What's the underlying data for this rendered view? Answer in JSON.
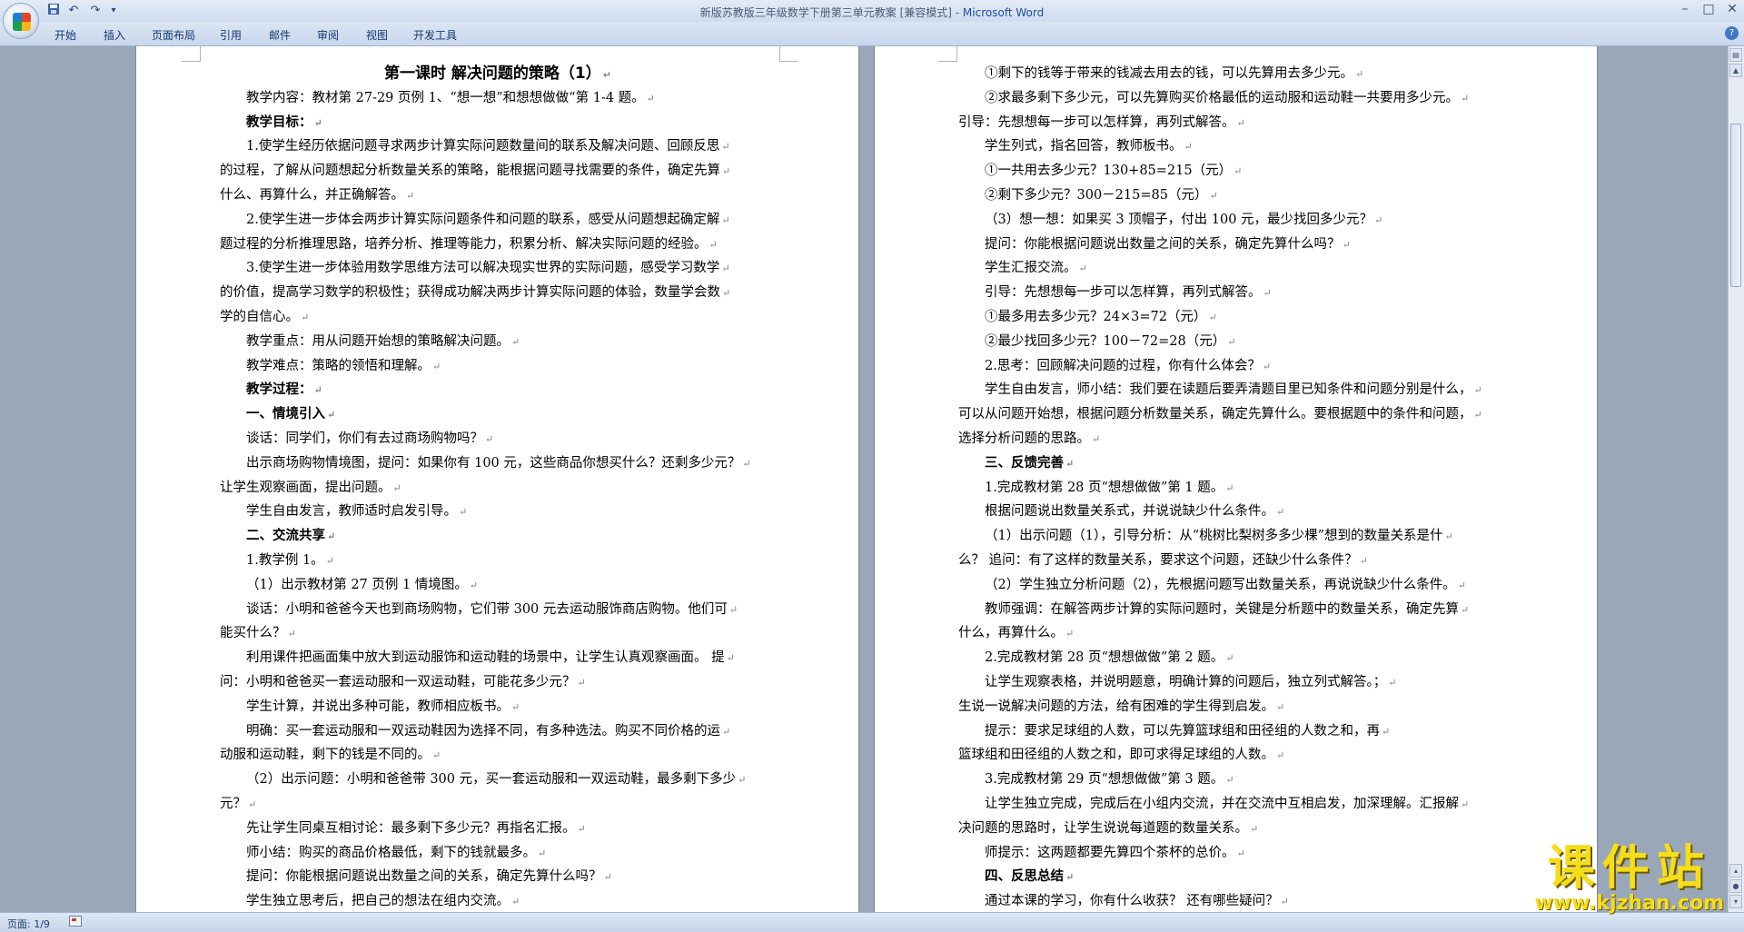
{
  "window": {
    "title": "新版苏教版三年级数学下册第三单元教案 [兼容模式] - ",
    "app_name": "Microsoft Word",
    "quick_access": {
      "save_icon": "save-icon",
      "undo": "↶",
      "redo": "↷",
      "customize": "▾"
    },
    "controls": {
      "minimize": "–",
      "maximize": "□",
      "close": "✕"
    }
  },
  "ribbon": {
    "tabs": [
      "开始",
      "插入",
      "页面布局",
      "引用",
      "邮件",
      "审阅",
      "视图",
      "开发工具"
    ],
    "help": "?"
  },
  "page_left": {
    "lines": [
      {
        "t": "第一课时  解决问题的策略（1）",
        "style": "title"
      },
      {
        "t": "教学内容：教材第 27-29 页例 1、“想一想”和想想做做“第 1-4 题。",
        "style": "ind"
      },
      {
        "t": "教学目标：",
        "style": "ind b"
      },
      {
        "t": "1.使学生经历依据问题寻求两步计算实际问题数量间的联系及解决问题、回顾反思",
        "style": "ind"
      },
      {
        "t": "的过程，了解从问题想起分析数量关系的策略，能根据问题寻找需要的条件，确定先算",
        "style": ""
      },
      {
        "t": "什么、再算什么，并正确解答。",
        "style": ""
      },
      {
        "t": "2.使学生进一步体会两步计算实际问题条件和问题的联系，感受从问题想起确定解",
        "style": "ind"
      },
      {
        "t": "题过程的分析推理思路，培养分析、推理等能力，积累分析、解决实际问题的经验。",
        "style": ""
      },
      {
        "t": "3.使学生进一步体验用数学思维方法可以解决现实世界的实际问题，感受学习数学",
        "style": "ind"
      },
      {
        "t": "的价值，提高学习数学的积极性；获得成功解决两步计算实际问题的体验，数量学会数",
        "style": ""
      },
      {
        "t": "学的自信心。",
        "style": ""
      },
      {
        "t": "教学重点：用从问题开始想的策略解决问题。",
        "style": "ind"
      },
      {
        "t": "教学难点：策略的领悟和理解。",
        "style": "ind"
      },
      {
        "t": "教学过程：",
        "style": "ind b"
      },
      {
        "t": "一、情境引入",
        "style": "ind b"
      },
      {
        "t": "谈话：同学们，你们有去过商场购物吗？",
        "style": "ind"
      },
      {
        "t": "出示商场购物情境图，提问：如果你有 100 元，这些商品你想买什么？还剩多少元？",
        "style": "ind"
      },
      {
        "t": "让学生观察画面，提出问题。",
        "style": ""
      },
      {
        "t": "学生自由发言，教师适时启发引导。",
        "style": "ind"
      },
      {
        "t": "二、交流共享",
        "style": "ind b"
      },
      {
        "t": "1.教学例 1。",
        "style": "ind"
      },
      {
        "t": "（1）出示教材第 27 页例 1 情境图。",
        "style": "ind"
      },
      {
        "t": "谈话：小明和爸爸今天也到商场购物，它们带 300 元去运动服饰商店购物。他们可",
        "style": "ind"
      },
      {
        "t": "能买什么？",
        "style": ""
      },
      {
        "t": "利用课件把画面集中放大到运动服饰和运动鞋的场景中，让学生认真观察画面。 提",
        "style": "ind"
      },
      {
        "t": "问：小明和爸爸买一套运动服和一双运动鞋，可能花多少元？",
        "style": ""
      },
      {
        "t": "学生计算，并说出多种可能，教师相应板书。",
        "style": "ind"
      },
      {
        "t": "明确：买一套运动服和一双运动鞋因为选择不同，有多种选法。购买不同价格的运",
        "style": "ind"
      },
      {
        "t": "动服和运动鞋，剩下的钱是不同的。",
        "style": ""
      },
      {
        "t": "（2）出示问题：小明和爸爸带 300 元，买一套运动服和一双运动鞋，最多剩下多少",
        "style": "ind"
      },
      {
        "t": "元？",
        "style": ""
      },
      {
        "t": "先让学生同桌互相讨论：最多剩下多少元？再指名汇报。",
        "style": "ind"
      },
      {
        "t": "师小结：购买的商品价格最低，剩下的钱就最多。",
        "style": "ind"
      },
      {
        "t": "提问：你能根据问题说出数量之间的关系，确定先算什么吗？",
        "style": "ind"
      },
      {
        "t": "学生独立思考后，把自己的想法在组内交流。",
        "style": "ind"
      }
    ]
  },
  "page_right": {
    "lines": [
      {
        "t": "①剩下的钱等于带来的钱减去用去的钱，可以先算用去多少元。",
        "style": "ind"
      },
      {
        "t": "②求最多剩下多少元，可以先算购买价格最低的运动服和运动鞋一共要用多少元。",
        "style": "ind"
      },
      {
        "t": "引导：先想想每一步可以怎样算，再列式解答。",
        "style": ""
      },
      {
        "t": "学生列式，指名回答，教师板书。",
        "style": "ind"
      },
      {
        "t": "①一共用去多少元？130+85=215（元）",
        "style": "ind"
      },
      {
        "t": "②剩下多少元？300－215=85（元）",
        "style": "ind"
      },
      {
        "t": "（3）想一想：如果买 3 顶帽子，付出 100 元，最少找回多少元？",
        "style": "ind"
      },
      {
        "t": "提问：你能根据问题说出数量之间的关系，确定先算什么吗？",
        "style": "ind"
      },
      {
        "t": "学生汇报交流。",
        "style": "ind"
      },
      {
        "t": "引导：先想想每一步可以怎样算，再列式解答。",
        "style": "ind"
      },
      {
        "t": "①最多用去多少元？24×3=72（元）",
        "style": "ind"
      },
      {
        "t": "②最少找回多少元？100－72=28（元）",
        "style": "ind"
      },
      {
        "t": "2.思考：回顾解决问题的过程，你有什么体会？",
        "style": "ind"
      },
      {
        "t": "学生自由发言，师小结：我们要在读题后要弄清题目里已知条件和问题分别是什么，",
        "style": "ind"
      },
      {
        "t": "可以从问题开始想，根据问题分析数量关系，确定先算什么。要根据题中的条件和问题，",
        "style": ""
      },
      {
        "t": "选择分析问题的思路。",
        "style": ""
      },
      {
        "t": "三、反馈完善",
        "style": "ind b"
      },
      {
        "t": "1.完成教材第 28 页“想想做做”第 1 题。",
        "style": "ind"
      },
      {
        "t": "根据问题说出数量关系式，并说说缺少什么条件。",
        "style": "ind"
      },
      {
        "t": "（1）出示问题（1），引导分析：从“桃树比梨树多多少棵”想到的数量关系是什",
        "style": "ind"
      },
      {
        "t": "么？ 追问：有了这样的数量关系，要求这个问题，还缺少什么条件？",
        "style": ""
      },
      {
        "t": "（2）学生独立分析问题（2），先根据问题写出数量关系，再说说缺少什么条件。",
        "style": "ind"
      },
      {
        "t": "教师强调：在解答两步计算的实际问题时，关键是分析题中的数量关系，确定先算",
        "style": "ind"
      },
      {
        "t": "什么，再算什么。",
        "style": ""
      },
      {
        "t": "2.完成教材第 28 页“想想做做”第 2 题。",
        "style": "ind"
      },
      {
        "t": "让学生观察表格，并说明题意，明确计算的问题后，独立列式解答。；",
        "style": "ind"
      },
      {
        "t": "生说一说解决问题的方法，给有困难的学生得到启发。",
        "style": ""
      },
      {
        "t": "提示：要求足球组的人数，可以先算篮球组和田径组的人数之和，再",
        "style": "ind"
      },
      {
        "t": "篮球组和田径组的人数之和，即可求得足球组的人数。",
        "style": ""
      },
      {
        "t": "3.完成教材第 29 页“想想做做”第 3 题。",
        "style": "ind"
      },
      {
        "t": "让学生独立完成，完成后在小组内交流，并在交流中互相启发，加深理解。汇报解",
        "style": "ind"
      },
      {
        "t": "决问题的思路时，让学生说说每道题的数量关系。",
        "style": ""
      },
      {
        "t": "师提示：这两题都要先算四个茶杯的总价。",
        "style": "ind"
      },
      {
        "t": "四、反思总结",
        "style": "ind b"
      },
      {
        "t": "通过本课的学习，你有什么收获？ 还有哪些疑问？",
        "style": "ind"
      }
    ]
  },
  "paragraph_mark": "↵",
  "statusbar": {
    "page_info": "页面: 1/9",
    "icon": "proofing-icon"
  },
  "watermark": {
    "main": "课件站",
    "url": "www.kjzhan.com"
  }
}
